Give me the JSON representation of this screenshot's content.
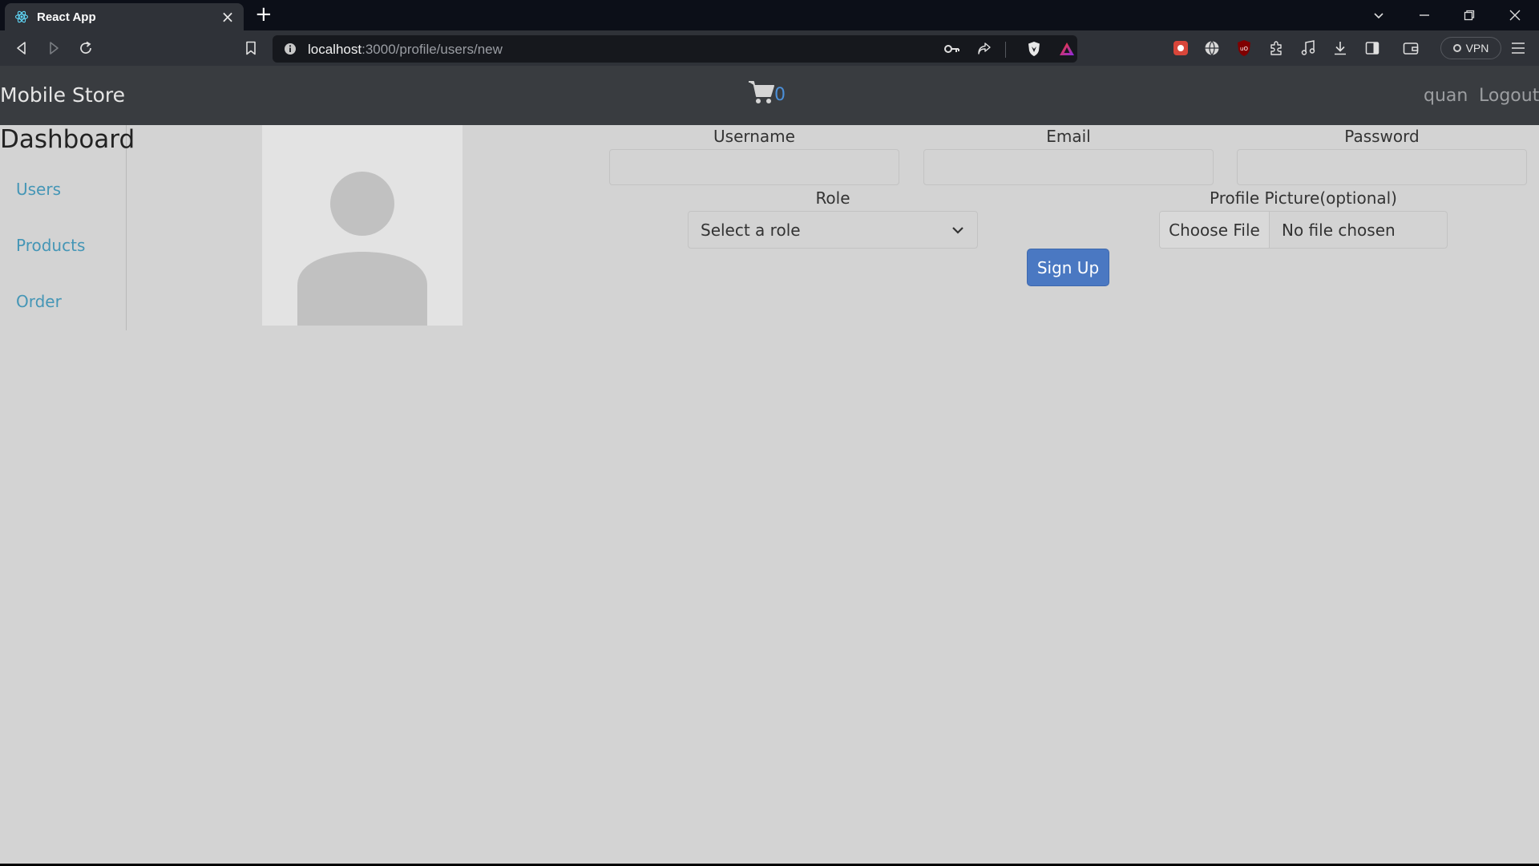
{
  "browser": {
    "tab_title": "React App",
    "url_host": "localhost",
    "url_path": ":3000/profile/users/new",
    "vpn_label": "VPN",
    "new_tab": "+",
    "tab_close": "×"
  },
  "navbar": {
    "brand": "Mobile Store",
    "cart_count": "0",
    "username": "quan",
    "logout": "Logout"
  },
  "sidebar": {
    "title": "Dashboard",
    "items": [
      {
        "label": "Users"
      },
      {
        "label": "Products"
      },
      {
        "label": "Order"
      }
    ]
  },
  "form": {
    "username_label": "Username",
    "username_value": "",
    "email_label": "Email",
    "email_value": "",
    "password_label": "Password",
    "password_value": "",
    "role_label": "Role",
    "role_selected": "Select a role",
    "picture_label": "Profile Picture(optional)",
    "choose_file": "Choose File",
    "no_file": "No file chosen",
    "submit": "Sign Up"
  },
  "colors": {
    "page_bg": "#d3d3d3",
    "navbar_bg": "#393c40",
    "link": "#4596b6",
    "button": "#4a78c2",
    "cart_count": "#4b8fd8"
  }
}
